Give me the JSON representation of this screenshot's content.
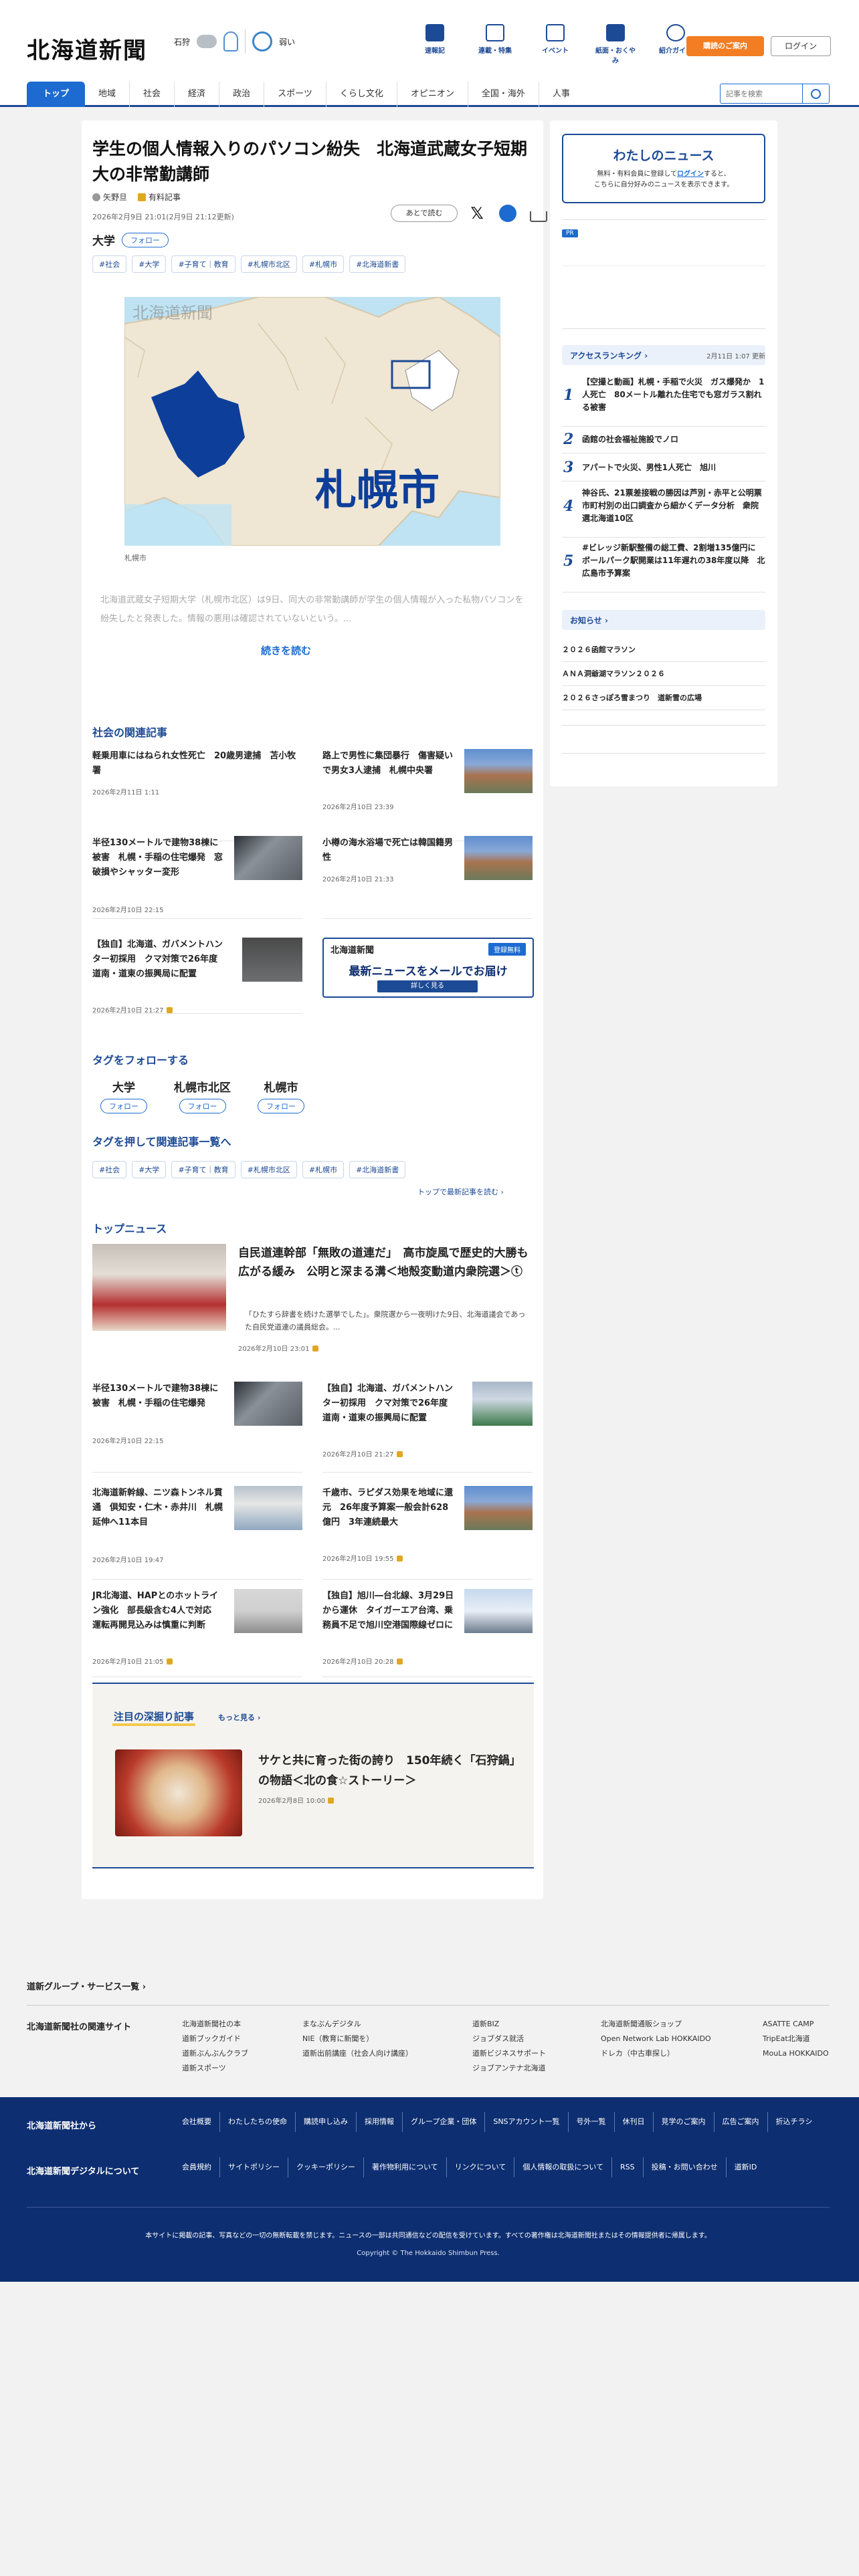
{
  "header": {
    "logo": "北海道新聞",
    "weather": {
      "place": "石狩",
      "uv": "弱い"
    },
    "icons": [
      {
        "label": "速報記",
        "icon": "bookmark-icon"
      },
      {
        "label": "連載・特集",
        "icon": "flag-icon"
      },
      {
        "label": "イベント",
        "icon": "calendar-icon"
      },
      {
        "label": "紙面・おくやみ",
        "icon": "newspaper-icon"
      },
      {
        "label": "紹介ガイド",
        "icon": "help-icon"
      }
    ],
    "guide_button": "購読のご案内",
    "login_button": "ログイン",
    "nav": [
      "トップ",
      "地域",
      "社会",
      "経済",
      "政治",
      "スポーツ",
      "くらし文化",
      "オピニオン",
      "全国・海外",
      "人事"
    ],
    "search_placeholder": "記事を検索"
  },
  "article": {
    "title": "学生の個人情報入りのパソコン紛失　北海道武蔵女子短期大の非常勤講師",
    "author": "矢野旦",
    "paid_label": "有料記事",
    "date": "2026年2月9日 21:01(2月9日 21:12更新)",
    "bookmark": "あとで読む",
    "main_tag": "大学",
    "follow": "フォロー",
    "tags": [
      "#社会",
      "#大学",
      "#子育て｜教育",
      "#札幌市北区",
      "#札幌市",
      "#北海道新書"
    ],
    "map_logo": "北海道新聞",
    "map_label": "札幌市",
    "map_caption": "札幌市",
    "lead": "北海道武蔵女子短期大学（札幌市北区）は9日、同大の非常勤講師が学生の個人情報が入った私物パソコンを紛失したと発表した。情報の悪用は確認されていないという。...",
    "read_more": "続きを読む"
  },
  "related": {
    "heading": "社会の関連記事",
    "items": [
      {
        "title": "軽乗用車にはねられ女性死亡　20歳男逮捕　苫小牧署",
        "date": "2026年2月11日 1:11"
      },
      {
        "title": "路上で男性に集団暴行　傷害疑いで男女3人逮捕　札幌中央署",
        "date": "2026年2月10日 23:39"
      },
      {
        "title": "半径130メートルで建物38棟に被害　札幌・手稲の住宅爆発　窓破損やシャッター変形",
        "date": "2026年2月10日 22:15"
      },
      {
        "title": "小樽の海水浴場で死亡は韓国籍男性",
        "date": "2026年2月10日 21:33"
      },
      {
        "title": "【独自】北海道、ガバメントハンター初採用　クマ対策で26年度　道南・道東の振興局に配置",
        "date": "2026年2月10日 21:27"
      }
    ],
    "banner": {
      "logo": "北海道新聞",
      "badge": "登録無料",
      "title": "最新ニュースをメールでお届け",
      "cta": "詳しく見る"
    }
  },
  "follow_tags": {
    "heading": "タグをフォローする",
    "tags": [
      "大学",
      "札幌市北区",
      "札幌市"
    ],
    "follow": "フォロー",
    "list_heading": "タグを押して関連記事一覧へ",
    "list_tags": [
      "#社会",
      "#大学",
      "#子育て｜教育",
      "#札幌市北区",
      "#札幌市",
      "#北海道新書"
    ],
    "to_top": "トップで最新記事を読む"
  },
  "top_news": {
    "heading": "トップニュース",
    "feature": {
      "title": "自民道連幹部「無敗の道連だ」　高市旋風で歴史的大勝も広がる緩み　公明と深まる溝＜地殻変動道内衆院選＞ⓣ",
      "summary": "「ひたすら辞書を続けた選挙でした」。衆院選から一夜明けた9日、北海道議会であった自民党道連の議員総会。...",
      "date": "2026年2月10日 23:01"
    },
    "items": [
      {
        "title": "半径130メートルで建物38棟に被害　札幌・手稲の住宅爆発",
        "date": "2026年2月10日 22:15"
      },
      {
        "title": "【独自】北海道、ガバメントハンター初採用　クマ対策で26年度　道南・道東の振興局に配置",
        "date": "2026年2月10日 21:27"
      },
      {
        "title": "北海道新幹線、ニツ森トンネル貫通　倶知安・仁木・赤井川　札幌延伸へ11本目",
        "date": "2026年2月10日 19:47"
      },
      {
        "title": "千歳市、ラピダス効果を地域に還元　26年度予算案一般会計628億円　3年連続最大",
        "date": "2026年2月10日 19:55"
      },
      {
        "title": "JR北海道、HAPとのホットライン強化　部長級含む4人で対応　運転再開見込みは慎重に判断",
        "date": "2026年2月10日 21:05"
      },
      {
        "title": "【独自】旭川―台北線、3月29日から運休　タイガーエア台湾、乗務員不足で旭川空港国際線ゼロに",
        "date": "2026年2月10日 20:28"
      }
    ]
  },
  "deep": {
    "heading": "注目の深掘り記事",
    "more": "もっと見る",
    "title": "サケと共に育った街の誇り　150年続く「石狩鍋」の物語＜北の食☆ストーリー＞",
    "date": "2026年2月8日 10:00"
  },
  "sidebar": {
    "mynews_title": "わたしのニュース",
    "mynews_desc1": "無料・有料会員に登録して",
    "mynews_login": "ログイン",
    "mynews_desc2": "すると、",
    "mynews_desc3": "こちらに自分好みのニュースを表示できます。",
    "pr": "PR",
    "ranking_title": "アクセスランキング",
    "ranking_updated": "2月11日 1:07 更新",
    "ranking": [
      {
        "rank": "1",
        "title": "【空撮と動画】札幌・手稲で火災　ガス爆発か　1人死亡　80メートル離れた住宅でも窓ガラス割れる被害"
      },
      {
        "rank": "2",
        "title": "函館の社会福祉施設でノロ"
      },
      {
        "rank": "3",
        "title": "アパートで火災、男性1人死亡　旭川"
      },
      {
        "rank": "4",
        "title": "神谷氏、21票差接戦の勝因は芦別・赤平と公明票　市町村別の出口調査から細かくデータ分析　衆院選北海道10区"
      },
      {
        "rank": "5",
        "title": "#ビレッジ新駅整備の総工費、2割増135億円に　ボールパーク駅開業は11年遅れの38年度以降　北広島市予算案"
      }
    ],
    "oshirase_title": "お知らせ",
    "oshirase": [
      "２０２６函館マラソン",
      "ＡＮＡ洞爺湖マラソン２０２６",
      "２０２６さっぽろ雪まつり　道新雪の広場"
    ]
  },
  "footer": {
    "group_heading": "道新グループ・サービス一覧",
    "related_sites": "北海道新聞社の関連サイト",
    "cols": [
      [
        "北海道新聞社の本",
        "道新ブックガイド",
        "道新ぶんぶんクラブ",
        "道新スポーツ"
      ],
      [
        "まなぶんデジタル",
        "NIE（教育に新聞を）",
        "道新出前講座（社会人向け講座）"
      ],
      [
        "道新BIZ",
        "ジョブダス就活",
        "道新ビジネスサポート",
        "ジョブアンテナ北海道"
      ],
      [
        "北海道新聞通販ショップ",
        "Open Network Lab HOKKAIDO",
        "ドレカ（中古車探し）"
      ],
      [
        "ASATTE CAMP",
        "TripEat北海道",
        "MouLa HOKKAIDO"
      ]
    ],
    "company_heading": "北海道新聞社から",
    "company_links": [
      "会社概要",
      "わたしたちの使命",
      "購読申し込み",
      "採用情報",
      "グループ企業・団体",
      "SNSアカウント一覧",
      "号外一覧",
      "休刊日",
      "見学のご案内",
      "広告ご案内",
      "折込チラシ"
    ],
    "digital_heading": "北海道新聞デジタルについて",
    "digital_links": [
      "会員規約",
      "サイトポリシー",
      "クッキーポリシー",
      "著作物利用について",
      "リンクについて",
      "個人情報の取扱について",
      "RSS",
      "投稿・お問い合わせ",
      "道新ID"
    ],
    "note": "本サイトに掲載の記事、写真などの一切の無断転載を禁じます。ニュースの一部は共同通信などの配信を受けています。すべての著作権は北海道新聞社またはその情報提供者に帰属します。",
    "copyright": "Copyright © The Hokkaido Shimbun Press."
  }
}
